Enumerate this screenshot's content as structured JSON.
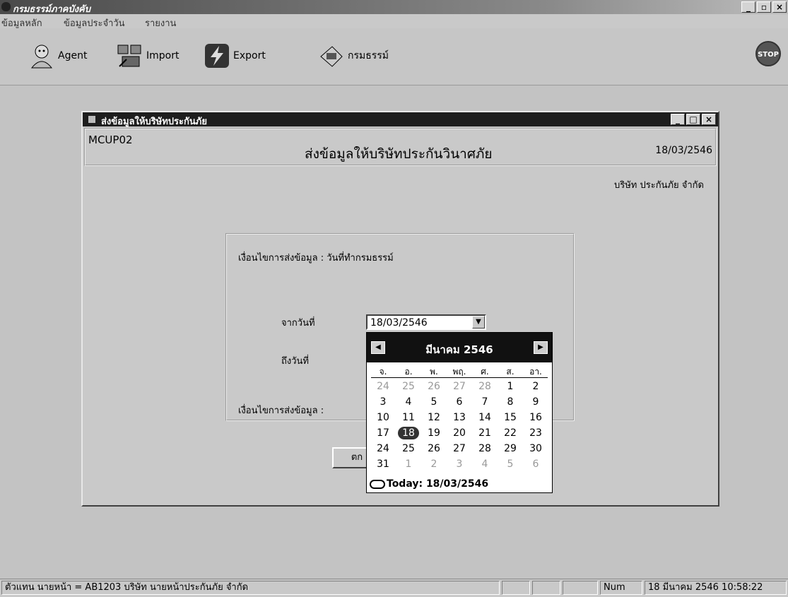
{
  "app": {
    "title": "กรมธรรม์ภาคบังคับ"
  },
  "menu": [
    "ข้อมูลหลัก",
    "ข้อมูลประจำวัน",
    "รายงาน"
  ],
  "toolbar": {
    "agent_label": "Agent",
    "import_label": "Import",
    "export_label": "Export",
    "policy_label": "กรมธรรม์",
    "stop_label": "STOP"
  },
  "window": {
    "title": "ส่งข้อมูลให้บริษัทประกันภัย",
    "code": "MCUP02",
    "form_title": "ส่งข้อมูลให้บริษัทประกันวินาศภัย",
    "date": "18/03/2546",
    "company": "บริษัท ประกันภัย จำกัด"
  },
  "form": {
    "condition_label": "เงื่อนไขการส่งข้อมูล : วันที่ทำกรมธรรม์",
    "from_label": "จากวันที่",
    "to_label": "ถึงวันที่",
    "condition2_label": "เงื่อนไขการส่งข้อมูล :",
    "from_value": "18/03/2546",
    "ok_label": "ตก"
  },
  "calendar": {
    "month_label": "มีนาคม 2546",
    "weekdays": [
      "จ.",
      "อ.",
      "พ.",
      "พฤ.",
      "ศ.",
      "ส.",
      "อา."
    ],
    "weeks": [
      [
        "24",
        "25",
        "26",
        "27",
        "28",
        "1",
        "2"
      ],
      [
        "3",
        "4",
        "5",
        "6",
        "7",
        "8",
        "9"
      ],
      [
        "10",
        "11",
        "12",
        "13",
        "14",
        "15",
        "16"
      ],
      [
        "17",
        "18",
        "19",
        "20",
        "21",
        "22",
        "23"
      ],
      [
        "24",
        "25",
        "26",
        "27",
        "28",
        "29",
        "30"
      ],
      [
        "31",
        "1",
        "2",
        "3",
        "4",
        "5",
        "6"
      ]
    ],
    "selected": "18",
    "today_label": "Today: 18/03/2546"
  },
  "status": {
    "user": "ตัวแทน นายหน้า = AB1203 บริษัท นายหน้าประกันภัย จำกัด",
    "num": "Num",
    "datetime": "18 มีนาคม 2546  10:58:22"
  }
}
